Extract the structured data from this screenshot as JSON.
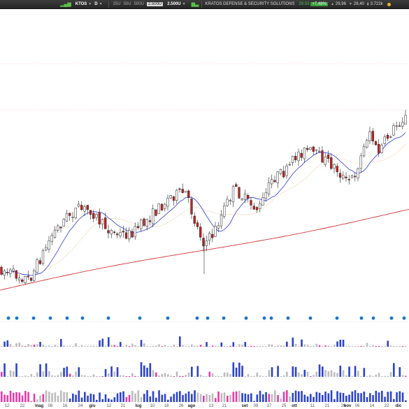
{
  "toolbar": {
    "symbol": "KTOS",
    "interval": "D",
    "timeframes": [
      "25U",
      "50U",
      "500U",
      "2.500U"
    ],
    "active_timeframe": "2.500U",
    "count": "2.500U",
    "company": "KRATOS DEFENSE & SECURITY SOLUTIONS",
    "price": "29,03",
    "change": "+7,48%",
    "high": "29,96",
    "low": "28,40",
    "volume": "3.722k"
  },
  "date_axis": [
    {
      "label": "12",
      "bold": false
    },
    {
      "label": "22",
      "bold": false
    },
    {
      "label": "mag",
      "bold": true
    },
    {
      "label": "08",
      "bold": false
    },
    {
      "label": "16",
      "bold": false
    },
    {
      "label": "24",
      "bold": false
    },
    {
      "label": "giu",
      "bold": true
    },
    {
      "label": "12",
      "bold": false
    },
    {
      "label": "21",
      "bold": false
    },
    {
      "label": "lug",
      "bold": true
    },
    {
      "label": "10",
      "bold": false
    },
    {
      "label": "18",
      "bold": false
    },
    {
      "label": "26",
      "bold": false
    },
    {
      "label": "ago",
      "bold": true
    },
    {
      "label": "13",
      "bold": false
    },
    {
      "label": "21",
      "bold": false
    },
    {
      "label": "set",
      "bold": true
    },
    {
      "label": "09",
      "bold": false
    },
    {
      "label": "17",
      "bold": false
    },
    {
      "label": "25",
      "bold": false
    },
    {
      "label": "ott",
      "bold": true
    },
    {
      "label": "11",
      "bold": false
    },
    {
      "label": "21",
      "bold": false
    },
    {
      "label": "29",
      "bold": false
    },
    {
      "label": "nov",
      "bold": true
    },
    {
      "label": "06",
      "bold": false
    },
    {
      "label": "14",
      "bold": false
    },
    {
      "label": "22",
      "bold": false
    },
    {
      "label": "dic",
      "bold": true
    }
  ],
  "colors": {
    "up": "#ffffff",
    "down": "#c62121",
    "wick": "#222222",
    "ma_fast": "#2b3bd6",
    "ma_mid": "#e0b070",
    "ma_slow": "#d21d1d",
    "vol_blue": "#2d44c8",
    "vol_grey": "#bcbcbc",
    "vol_pink": "#e83ca8",
    "dots": "#1d74c9"
  }
}
